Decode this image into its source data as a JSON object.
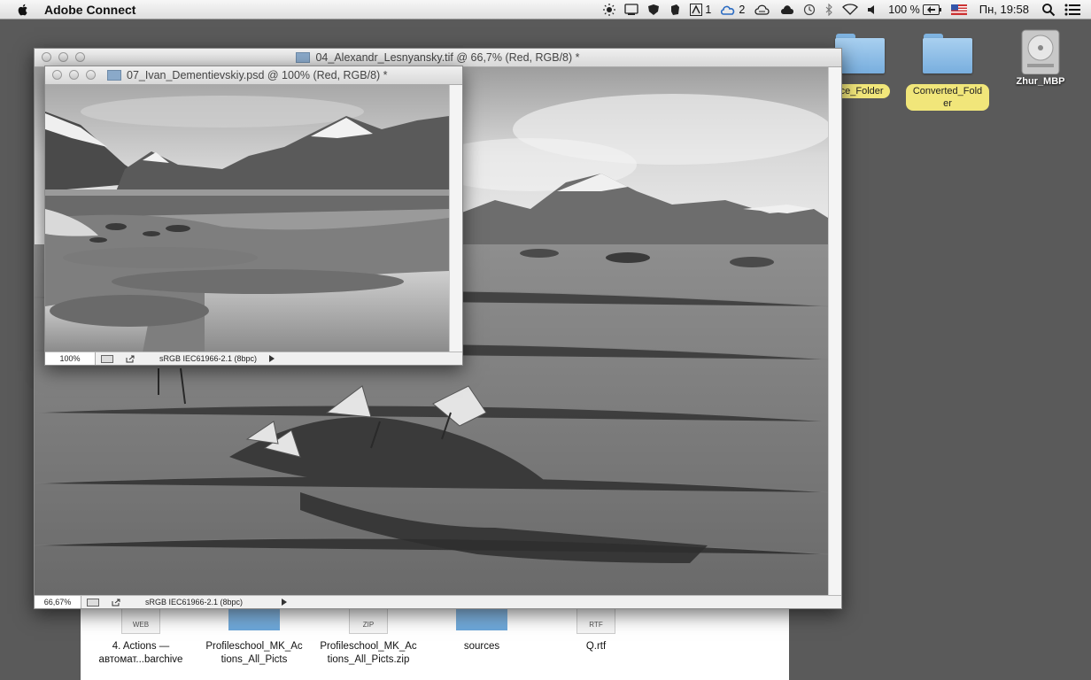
{
  "menubar": {
    "app_name": "Adobe Connect",
    "adobe_count": "1",
    "cloud_count": "2",
    "battery": "100 %",
    "clock": "Пн, 19:58"
  },
  "desktop": {
    "icons": [
      {
        "label": "rce_Folder",
        "type": "folder"
      },
      {
        "label": "Converted_Folder",
        "type": "folder"
      },
      {
        "label": "Zhur_MBP",
        "type": "hard-drive"
      }
    ]
  },
  "finder": {
    "items": [
      {
        "label": "4. Actions — автомат...barchive",
        "badge": "WEB",
        "kind": "document"
      },
      {
        "label": "Profileschool_MK_Actions_All_Picts",
        "badge": "",
        "kind": "folder"
      },
      {
        "label": "Profileschool_MK_Actions_All_Picts.zip",
        "badge": "ZIP",
        "kind": "document"
      },
      {
        "label": "sources",
        "badge": "",
        "kind": "folder"
      },
      {
        "label": "Q.rtf",
        "badge": "RTF",
        "kind": "document"
      }
    ]
  },
  "windows": {
    "back": {
      "title": "04_Alexandr_Lesnyansky.tif @ 66,7% (Red, RGB/8) *",
      "zoom": "66,67%",
      "profile": "sRGB IEC61966-2.1 (8bpc)"
    },
    "front": {
      "title": "07_Ivan_Dementievskiy.psd @ 100% (Red, RGB/8) *",
      "zoom": "100%",
      "profile": "sRGB IEC61966-2.1 (8bpc)"
    }
  }
}
